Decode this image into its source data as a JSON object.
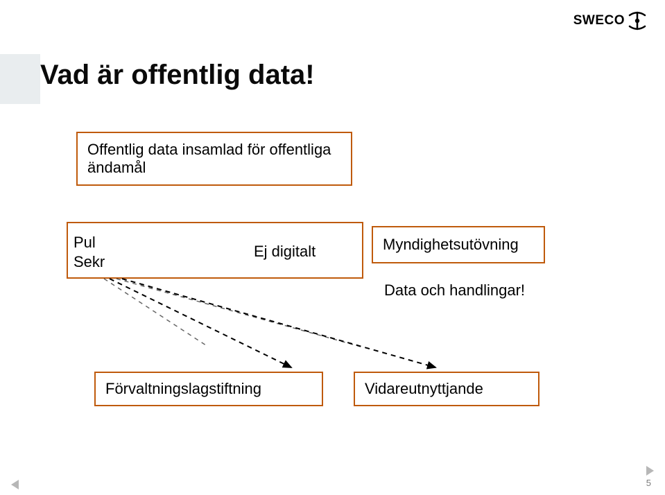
{
  "brand": {
    "name": "SWECO"
  },
  "title": "Vad är offentlig data!",
  "boxes": {
    "top": "Offentlig data insamlad för offentliga ändamål",
    "mid_left_line1": "Pul",
    "mid_left_line2": "Sekr",
    "mid_right": "Ej digitalt",
    "myndig": "Myndighetsutövning",
    "mid_caption": "Data och handlingar!",
    "bottom_left": "Förvaltningslagstiftning",
    "bottom_right": "Vidareutnyttjande"
  },
  "page_number": "5"
}
